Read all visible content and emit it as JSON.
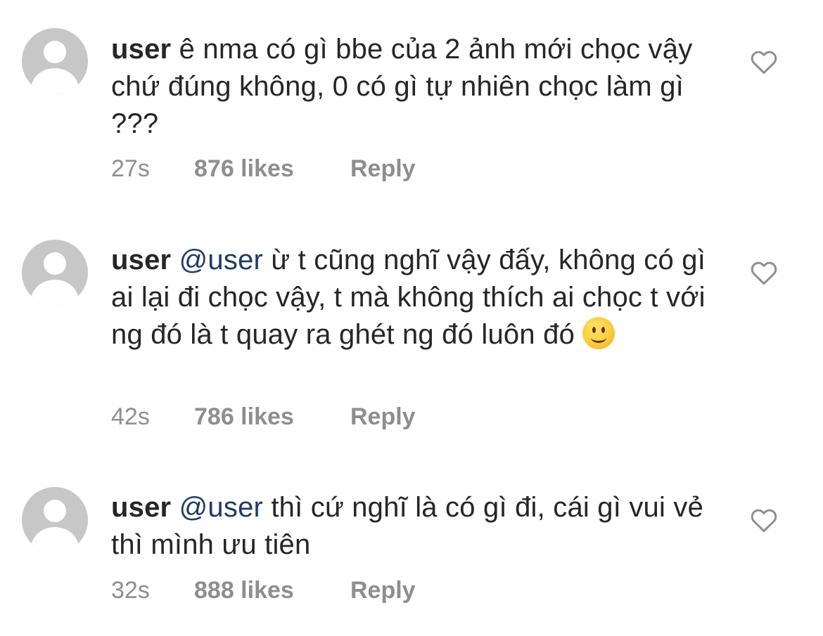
{
  "comments": [
    {
      "username": "user",
      "mention": "",
      "text": " ê nma có gì bbe của 2 ảnh mới chọc vậy chứ đúng không, 0 có gì tự nhiên chọc làm gì ???",
      "time": "27s",
      "likes": "876 likes",
      "reply": "Reply",
      "has_emoji": false
    },
    {
      "username": "user",
      "mention": "@user",
      "text": " ừ t cũng nghĩ vậy đấy, không có gì ai lại đi chọc vậy, t mà không thích ai chọc t với ng đó là t quay ra ghét ng đó luôn đó ",
      "time": "42s",
      "likes": "786 likes",
      "reply": "Reply",
      "has_emoji": true,
      "emoji": "slightly-smiling-face"
    },
    {
      "username": "user",
      "mention": "@user",
      "text": " thì cứ nghĩ là có gì đi, cái gì vui vẻ thì mình ưu tiên",
      "time": "32s",
      "likes": "888 likes",
      "reply": "Reply",
      "has_emoji": false
    }
  ],
  "icons": {
    "like": "heart-outline-icon",
    "avatar": "default-avatar-icon"
  },
  "colors": {
    "text": "#262626",
    "mention": "#1f3a69",
    "meta": "#8e8e8e",
    "avatar_bg": "#c7c7c7"
  }
}
